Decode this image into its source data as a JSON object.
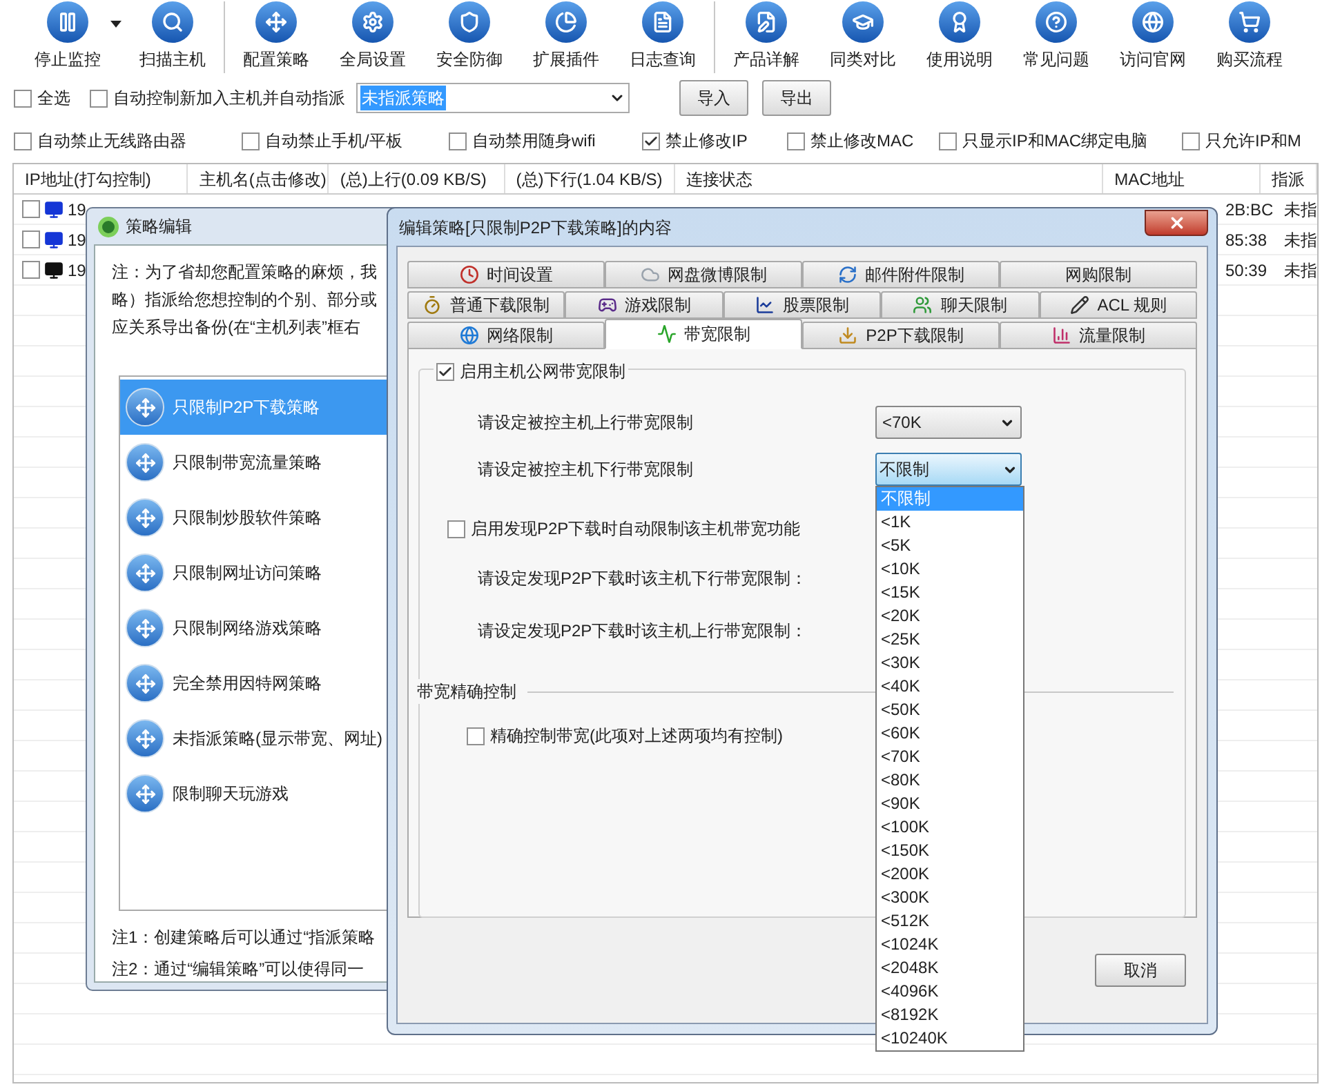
{
  "toolbar": {
    "groups": [
      [
        {
          "label": "停止监控",
          "has_menu": true
        },
        {
          "label": "扫描主机",
          "has_menu": false
        }
      ],
      [
        {
          "label": "配置策略",
          "has_menu": false
        },
        {
          "label": "全局设置",
          "has_menu": false
        },
        {
          "label": "安全防御",
          "has_menu": false
        },
        {
          "label": "扩展插件",
          "has_menu": false
        },
        {
          "label": "日志查询",
          "has_menu": false
        }
      ],
      [
        {
          "label": "产品详解",
          "has_menu": false
        },
        {
          "label": "同类对比",
          "has_menu": false
        },
        {
          "label": "使用说明",
          "has_menu": false
        },
        {
          "label": "常见问题",
          "has_menu": false
        },
        {
          "label": "访问官网",
          "has_menu": false
        },
        {
          "label": "购买流程",
          "has_menu": false
        }
      ]
    ]
  },
  "options": {
    "select_all": {
      "label": "全选",
      "checked": false
    },
    "auto_assign": {
      "label": "自动控制新加入主机并自动指派",
      "checked": false
    },
    "policy_select": {
      "value": "未指派策略"
    },
    "buttons": [
      "导入",
      "导出"
    ],
    "checkboxes": [
      {
        "label": "自动禁止无线路由器",
        "checked": false
      },
      {
        "label": "自动禁止手机/平板",
        "checked": false
      },
      {
        "label": "自动禁用随身wifi",
        "checked": false
      },
      {
        "label": "禁止修改IP",
        "checked": true
      },
      {
        "label": "禁止修改MAC",
        "checked": false
      },
      {
        "label": "只显示IP和MAC绑定电脑",
        "checked": false
      },
      {
        "label": "只允许IP和M",
        "checked": false
      }
    ]
  },
  "host_table": {
    "columns": [
      "IP地址(打勾控制)",
      "主机名(点击修改)",
      "(总)上行(0.09 KB/S)",
      "(总)下行(1.04 KB/S)",
      "连接状态",
      "MAC地址",
      "指派"
    ],
    "rows": [
      {
        "checked": false,
        "color": "#1536d6",
        "ip": "19",
        "mac": "2B:BC",
        "assigned": "未指"
      },
      {
        "checked": false,
        "color": "#1536d6",
        "ip": "19",
        "mac": "85:38",
        "assigned": "未指"
      },
      {
        "checked": false,
        "color": "#111111",
        "ip": "19",
        "mac": "50:39",
        "assigned": "未指"
      }
    ]
  },
  "policy_dialog": {
    "title": "策略编辑",
    "note_lines": [
      "注：为了省却您配置策略的麻烦，我",
      "略）指派给您想控制的个别、部分或",
      "应关系导出备份(在“主机列表”框右"
    ],
    "policies": [
      {
        "label": "只限制P2P下载策略",
        "selected": true
      },
      {
        "label": "只限制带宽流量策略",
        "selected": false
      },
      {
        "label": "只限制炒股软件策略",
        "selected": false
      },
      {
        "label": "只限制网址访问策略",
        "selected": false
      },
      {
        "label": "只限制网络游戏策略",
        "selected": false
      },
      {
        "label": "完全禁用因特网策略",
        "selected": false
      },
      {
        "label": "未指派策略(显示带宽、网址)",
        "selected": false
      },
      {
        "label": "限制聊天玩游戏",
        "selected": false
      }
    ],
    "footnotes": [
      "注1：创建策略后可以通过“指派策略",
      "注2：通过“编辑策略”可以使得同一"
    ]
  },
  "edit_dialog": {
    "title": "编辑策略[只限制P2P下载策略]的内容",
    "tab_rows": [
      [
        {
          "label": "时间设置",
          "selected": false
        },
        {
          "label": "网盘微博限制",
          "selected": false
        },
        {
          "label": "邮件附件限制",
          "selected": false
        },
        {
          "label": "网购限制",
          "selected": false
        }
      ],
      [
        {
          "label": "普通下载限制",
          "selected": false
        },
        {
          "label": "游戏限制",
          "selected": false
        },
        {
          "label": "股票限制",
          "selected": false
        },
        {
          "label": "聊天限制",
          "selected": false
        },
        {
          "label": "ACL 规则",
          "selected": false
        }
      ],
      [
        {
          "label": "网络限制",
          "selected": false
        },
        {
          "label": "带宽限制",
          "selected": true
        },
        {
          "label": "P2P下载限制",
          "selected": false
        },
        {
          "label": "流量限制",
          "selected": false
        }
      ]
    ],
    "bandwidth": {
      "enable": {
        "label": "启用主机公网带宽限制",
        "checked": true
      },
      "upload": {
        "label": "请设定被控主机上行带宽限制",
        "value": "<70K"
      },
      "download": {
        "label": "请设定被控主机下行带宽限制",
        "value": "不限制",
        "open": true
      },
      "p2p_auto": {
        "label": "启用发现P2P下载时自动限制该主机带宽功能",
        "checked": false
      },
      "p2p_download_label": "请设定发现P2P下载时该主机下行带宽限制：",
      "p2p_upload_label": "请设定发现P2P下载时该主机上行带宽限制：",
      "section_title": "带宽精确控制",
      "precise": {
        "label": "精确控制带宽(此项对上述两项均有控制)",
        "checked": false
      }
    },
    "dropdown_options": [
      {
        "label": "不限制",
        "selected": true
      },
      {
        "label": "<1K",
        "selected": false
      },
      {
        "label": "<5K",
        "selected": false
      },
      {
        "label": "<10K",
        "selected": false
      },
      {
        "label": "<15K",
        "selected": false
      },
      {
        "label": "<20K",
        "selected": false
      },
      {
        "label": "<25K",
        "selected": false
      },
      {
        "label": "<30K",
        "selected": false
      },
      {
        "label": "<40K",
        "selected": false
      },
      {
        "label": "<50K",
        "selected": false
      },
      {
        "label": "<60K",
        "selected": false
      },
      {
        "label": "<70K",
        "selected": false
      },
      {
        "label": "<80K",
        "selected": false
      },
      {
        "label": "<90K",
        "selected": false
      },
      {
        "label": "<100K",
        "selected": false
      },
      {
        "label": "<150K",
        "selected": false
      },
      {
        "label": "<200K",
        "selected": false
      },
      {
        "label": "<300K",
        "selected": false
      },
      {
        "label": "<512K",
        "selected": false
      },
      {
        "label": "<1024K",
        "selected": false
      },
      {
        "label": "<2048K",
        "selected": false
      },
      {
        "label": "<4096K",
        "selected": false
      },
      {
        "label": "<8192K",
        "selected": false
      },
      {
        "label": "<10240K",
        "selected": false
      }
    ],
    "cancel_button": "取消"
  }
}
